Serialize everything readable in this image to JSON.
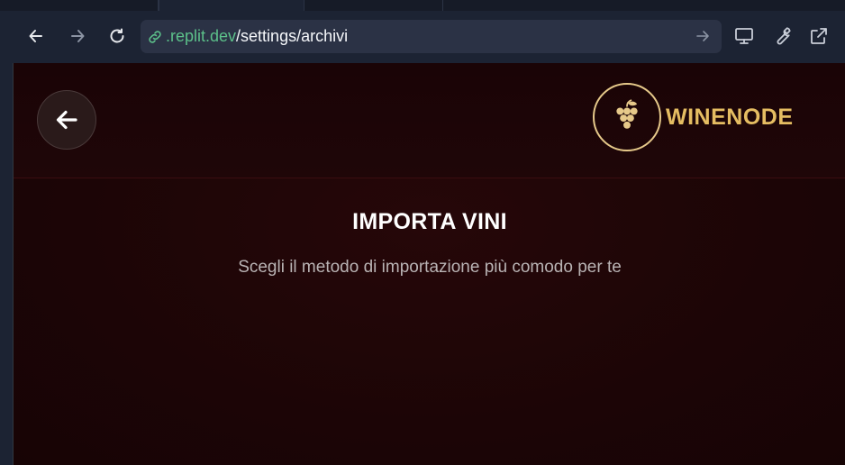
{
  "browser": {
    "url_domain": ".replit.dev",
    "url_path": "/settings/archivi",
    "icons": {
      "back": "arrow-left-icon",
      "forward": "arrow-right-icon",
      "reload": "reload-icon",
      "link": "link-icon",
      "go": "arrow-right-icon",
      "devices": "monitor-icon",
      "devtools": "wrench-icon",
      "open_external": "external-link-icon"
    }
  },
  "app": {
    "brand": "WINENODE",
    "title": "IMPORTA VINI",
    "subtitle": "Scegli il metodo di importazione più comodo per te",
    "colors": {
      "brand_gold": "#e5bd62",
      "background": "#1c0506"
    }
  }
}
